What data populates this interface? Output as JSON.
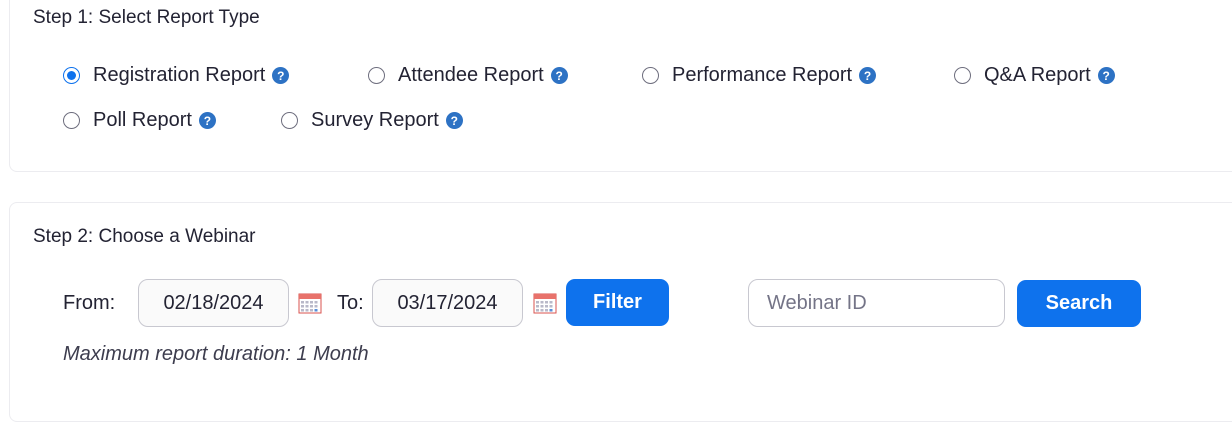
{
  "step1": {
    "title": "Step 1: Select Report Type",
    "options": [
      {
        "label": "Registration Report",
        "selected": true
      },
      {
        "label": "Attendee Report",
        "selected": false
      },
      {
        "label": "Performance Report",
        "selected": false
      },
      {
        "label": "Q&A Report",
        "selected": false
      },
      {
        "label": "Poll Report",
        "selected": false
      },
      {
        "label": "Survey Report",
        "selected": false
      }
    ],
    "help_icon": "?"
  },
  "step2": {
    "title": "Step 2: Choose a Webinar",
    "from_label": "From:",
    "from_date": "02/18/2024",
    "to_label": "To:",
    "to_date": "03/17/2024",
    "filter_label": "Filter",
    "webinar_id_placeholder": "Webinar ID",
    "search_label": "Search",
    "note": "Maximum report duration: 1 Month"
  },
  "colors": {
    "accent": "#0e72ed",
    "help_icon": "#2d72c4"
  },
  "icons": {
    "help": "question-circle-icon",
    "calendar": "calendar-icon"
  }
}
